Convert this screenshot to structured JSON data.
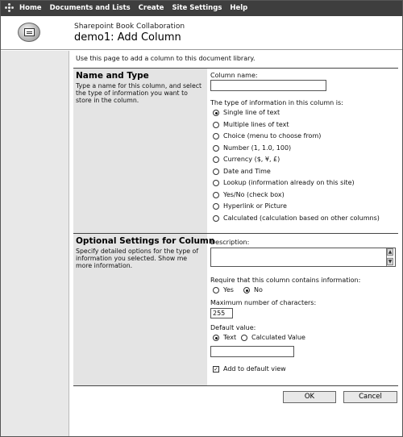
{
  "topnav": {
    "items": [
      "Home",
      "Documents and Lists",
      "Create",
      "Site Settings",
      "Help"
    ]
  },
  "header": {
    "site_name": "Sharepoint Book Collaboration",
    "page_title": "demo1: Add Column"
  },
  "intro": "Use this page to add a column to this document library.",
  "name_type": {
    "title": "Name and Type",
    "description": "Type a name for this column, and select the type of information you want to store in the column.",
    "column_name_label": "Column name:",
    "column_name_value": "",
    "type_label": "The type of information in this column is:",
    "types": [
      "Single line of text",
      "Multiple lines of text",
      "Choice (menu to choose from)",
      "Number (1, 1.0, 100)",
      "Currency ($, ¥, £)",
      "Date and Time",
      "Lookup (information already on this site)",
      "Yes/No (check box)",
      "Hyperlink or Picture",
      "Calculated (calculation based on other columns)"
    ],
    "selected_type": "Single line of text"
  },
  "optional": {
    "title": "Optional Settings for Column",
    "description": "Specify detailed options for the type of information you selected.",
    "show_more_link": "Show me more information.",
    "description_label": "Description:",
    "description_value": "",
    "require_label": "Require that this column contains information:",
    "require_yes": "Yes",
    "require_no": "No",
    "require_selected": "No",
    "max_chars_label": "Maximum number of characters:",
    "max_chars_value": "255",
    "default_label": "Default value:",
    "default_text": "Text",
    "default_calculated": "Calculated Value",
    "default_selected": "Text",
    "default_value": "",
    "add_default_view_label": "Add to default view",
    "add_default_view_checked": true
  },
  "buttons": {
    "ok": "OK",
    "cancel": "Cancel"
  }
}
